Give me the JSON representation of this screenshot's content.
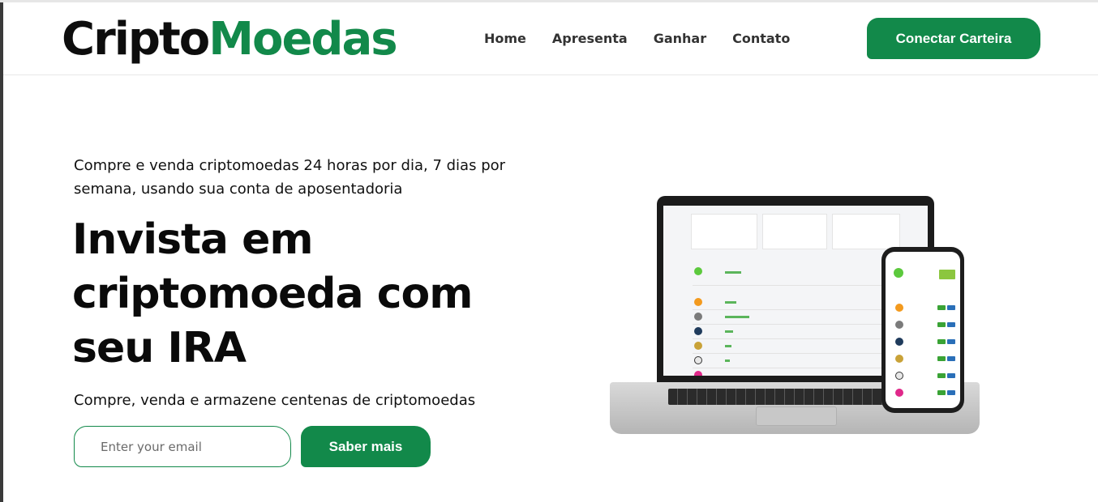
{
  "brand": {
    "part1": "Cripto",
    "part2": "Moedas"
  },
  "nav": {
    "items": [
      {
        "label": "Home"
      },
      {
        "label": "Apresenta"
      },
      {
        "label": "Ganhar"
      },
      {
        "label": "Contato"
      }
    ]
  },
  "header": {
    "connect_label": "Conectar Carteira"
  },
  "hero": {
    "subtitle": "Compre e venda criptomoedas 24 horas por dia, 7 dias por semana, usando sua conta de aposentadoria",
    "title": "Invista em criptomoeda com seu IRA",
    "description": "Compre, venda e armazene centenas de criptomoedas",
    "email_placeholder": "Enter your email",
    "cta_label": "Saber mais"
  },
  "colors": {
    "accent": "#12894a",
    "text": "#0a0a0a"
  },
  "illustration": {
    "icon": "laptop-and-phone-dashboard"
  }
}
